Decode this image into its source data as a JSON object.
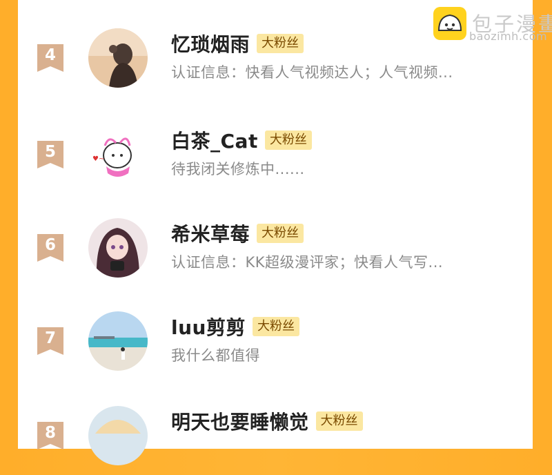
{
  "watermark": {
    "title": "包子漫畫",
    "subtitle": "baozimh.com"
  },
  "fans": [
    {
      "rank": "4",
      "name": "忆琐烟雨",
      "badge": "大粉丝",
      "desc": "认证信息：快看人气视频达人；人气视频..."
    },
    {
      "rank": "5",
      "name": "白茶_Cat",
      "badge": "大粉丝",
      "desc": "待我闭关修炼中......"
    },
    {
      "rank": "6",
      "name": "希米草莓",
      "badge": "大粉丝",
      "desc": "认证信息：KK超级漫评家；快看人气写..."
    },
    {
      "rank": "7",
      "name": "luu剪剪",
      "badge": "大粉丝",
      "desc": "我什么都值得"
    },
    {
      "rank": "8",
      "name": "明天也要睡懒觉",
      "badge": "大粉丝",
      "desc": ""
    }
  ],
  "colors": {
    "rank_bg": "#d9b08f",
    "badge_bg": "#fbe7a1",
    "border": "#ffae2a"
  }
}
